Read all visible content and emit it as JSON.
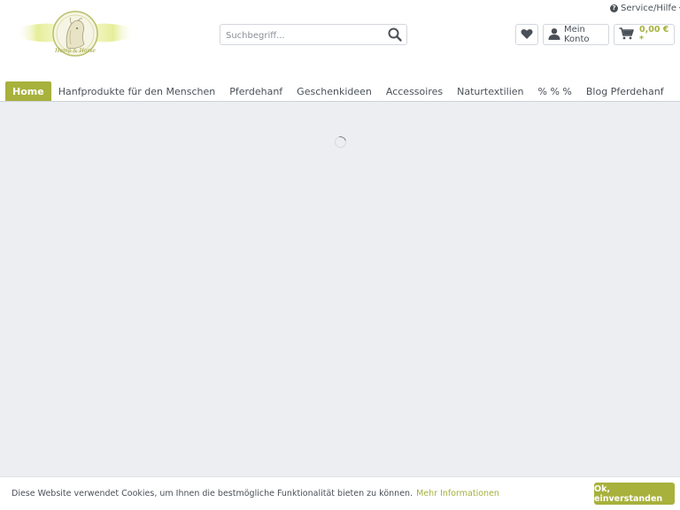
{
  "header": {
    "service_label": "Service/Hilfe",
    "search_placeholder": "Suchbegriff...",
    "account_label": "Mein Konto",
    "cart_price": "0,00 € *",
    "logo_text": "Hemp & Horse"
  },
  "nav": {
    "items": [
      {
        "label": "Home"
      },
      {
        "label": "Hanfprodukte für den Menschen"
      },
      {
        "label": "Pferdehanf"
      },
      {
        "label": "Geschenkideen"
      },
      {
        "label": "Accessoires"
      },
      {
        "label": "Naturtextilien"
      },
      {
        "label": "% % %"
      },
      {
        "label": "Blog Pferdehanf"
      }
    ]
  },
  "cookie": {
    "text": "Diese Website verwendet Cookies, um Ihnen die bestmögliche Funktionalität bieten zu können.",
    "link": "Mehr Informationen",
    "button": "Ok, einverstanden"
  },
  "colors": {
    "accent": "#a7b13c",
    "background": "#eceef2",
    "text": "#4a5057"
  }
}
